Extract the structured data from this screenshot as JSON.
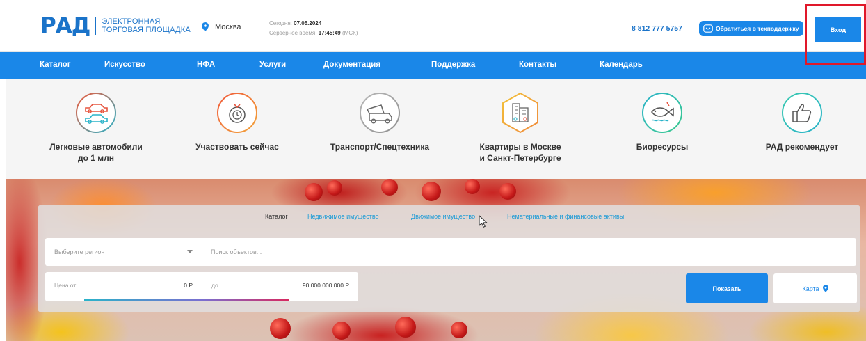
{
  "header": {
    "logo_mark": "РАД",
    "logo_line1": "ЭЛЕКТРОННАЯ",
    "logo_line2": "ТОРГОВАЯ ПЛОЩАДКА",
    "city": "Москва",
    "today_label": "Сегодня:",
    "today_value": "07.05.2024",
    "server_time_label": "Серверное время:",
    "server_time_value": "17:45:49",
    "server_time_zone": "(МСК)",
    "phone": "8 812 777 5757",
    "support_label": "Обратиться в техподдержку",
    "login_label": "Вход"
  },
  "nav": {
    "items": [
      {
        "label": "Каталог"
      },
      {
        "label": "Искусство"
      },
      {
        "label": "НФА"
      },
      {
        "label": "Услуги"
      },
      {
        "label": "Документация"
      },
      {
        "label": "Поддержка"
      },
      {
        "label": "Контакты"
      },
      {
        "label": "Календарь"
      }
    ]
  },
  "categories": [
    {
      "line1": "Легковые автомобили",
      "line2": "до 1 млн",
      "icon": "cars-icon"
    },
    {
      "line1": "Участвовать сейчас",
      "line2": "",
      "icon": "timer-icon"
    },
    {
      "line1": "Транспорт/Спецтехника",
      "line2": "",
      "icon": "dump-truck-icon"
    },
    {
      "line1": "Квартиры в Москве",
      "line2": "и Санкт-Петербурге",
      "icon": "apartments-icon"
    },
    {
      "line1": "Биоресурсы",
      "line2": "",
      "icon": "fish-icon"
    },
    {
      "line1": "РАД рекомендует",
      "line2": "",
      "icon": "thumbs-up-icon"
    }
  ],
  "search": {
    "tabs": [
      {
        "label": "Каталог",
        "active": true
      },
      {
        "label": "Недвижимое имущество",
        "active": false
      },
      {
        "label": "Движимое имущество",
        "active": false
      },
      {
        "label": "Нематериальные и финансовые активы",
        "active": false
      }
    ],
    "region_placeholder": "Выберите регион",
    "query_placeholder": "Поиск объектов...",
    "price_from_label": "Цена от",
    "price_from_value": "0 Р",
    "price_to_label": "до",
    "price_to_value": "90 000 000 000 Р",
    "show_label": "Показать",
    "map_label": "Карта"
  },
  "colors": {
    "brand_blue": "#1a87e8",
    "logo_blue": "#1a73c9",
    "tab_link": "#1a9ad6",
    "highlight_red": "#e0182a"
  }
}
